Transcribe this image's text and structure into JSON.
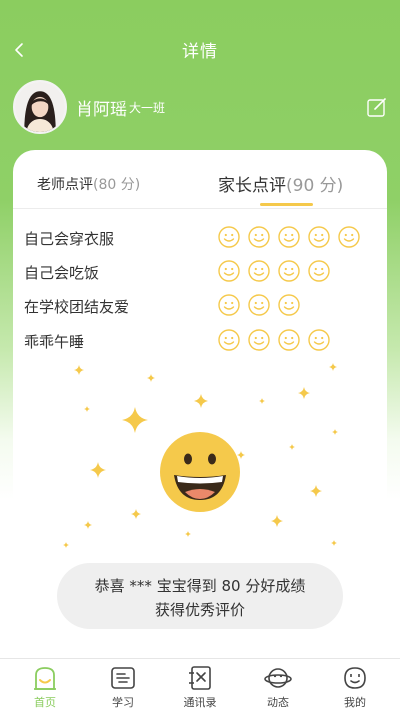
{
  "header": {
    "title": "详情"
  },
  "student": {
    "name": "肖阿瑶",
    "class": "大一班"
  },
  "tabs": {
    "teacher": {
      "label": "老师点评",
      "score": "(80 分)"
    },
    "parent": {
      "label": "家长点评",
      "score": "(90 分)"
    }
  },
  "ratings": [
    {
      "label": "自己会穿衣服",
      "faces": 5
    },
    {
      "label": "自己会吃饭",
      "faces": 4
    },
    {
      "label": "在学校团结友爱",
      "faces": 3
    },
    {
      "label": "乖乖午睡",
      "faces": 4
    }
  ],
  "congrats": {
    "line1": "恭喜 *** 宝宝得到 80 分好成绩",
    "line2": "获得优秀评价"
  },
  "tabbar": [
    {
      "label": "首页",
      "icon": "home-icon",
      "active": true
    },
    {
      "label": "学习",
      "icon": "study-icon",
      "active": false
    },
    {
      "label": "通讯录",
      "icon": "contacts-icon",
      "active": false
    },
    {
      "label": "动态",
      "icon": "planet-icon",
      "active": false
    },
    {
      "label": "我的",
      "icon": "profile-face-icon",
      "active": false
    }
  ],
  "colors": {
    "accent_green": "#8bcd5f",
    "face_yellow": "#f5c94b",
    "tab_underline": "#f5c94b"
  }
}
